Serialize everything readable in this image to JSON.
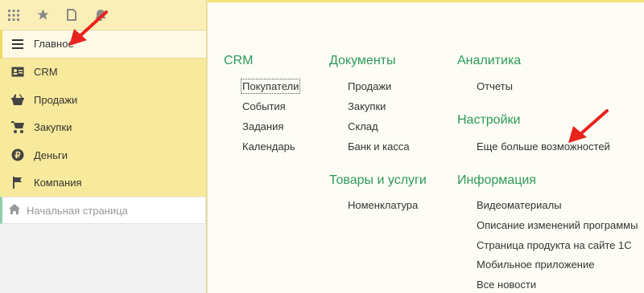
{
  "sidebar": {
    "toolbar": {
      "icons": [
        "apps-grid-icon",
        "star-icon",
        "history-icon",
        "bell-icon"
      ]
    },
    "items": [
      {
        "label": "Главное",
        "icon": "menu-lines-icon",
        "active": true
      },
      {
        "label": "CRM",
        "icon": "contact-card-icon"
      },
      {
        "label": "Продажи",
        "icon": "basket-icon"
      },
      {
        "label": "Закупки",
        "icon": "cart-icon"
      },
      {
        "label": "Деньги",
        "icon": "ruble-coin-icon"
      },
      {
        "label": "Компания",
        "icon": "flag-icon"
      }
    ],
    "start_page": {
      "label": "Начальная страница",
      "icon": "home-icon"
    }
  },
  "main": {
    "crm": {
      "title": "CRM",
      "links": [
        "Покупатели",
        "События",
        "Задания",
        "Календарь"
      ]
    },
    "documents": {
      "title": "Документы",
      "links": [
        "Продажи",
        "Закупки",
        "Склад",
        "Банк и касса"
      ]
    },
    "goods": {
      "title": "Товары и услуги",
      "links": [
        "Номенклатура"
      ]
    },
    "analytics": {
      "title": "Аналитика",
      "links": [
        "Отчеты"
      ]
    },
    "settings": {
      "title": "Настройки",
      "links": [
        "Еще больше возможностей"
      ]
    },
    "info": {
      "title": "Информация",
      "links": [
        "Видеоматериалы",
        "Описание изменений программы",
        "Страница продукта на сайте 1С",
        "Мобильное приложение",
        "Все новости"
      ]
    }
  },
  "colors": {
    "accent_green": "#2d9a5a",
    "sidebar_yellow": "#f8ea9c",
    "arrow_red": "#e8231c"
  }
}
